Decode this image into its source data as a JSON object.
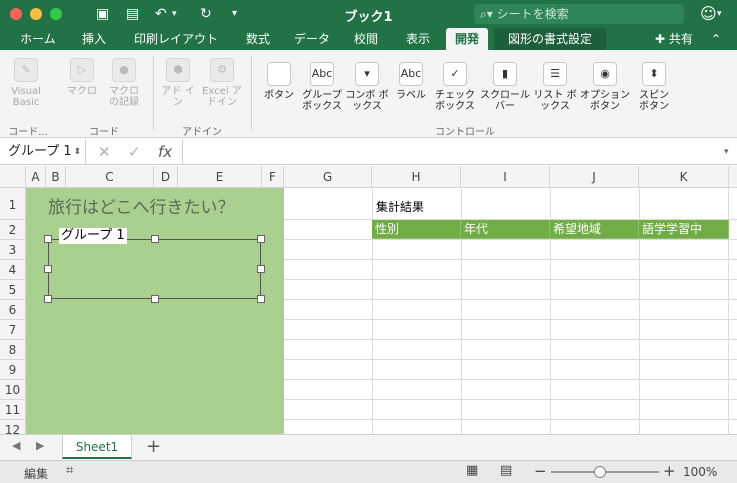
{
  "window": {
    "title": "ブック1",
    "search_placeholder": "シートを検索"
  },
  "toolbar": {
    "undo_label": "↶",
    "redo_label": "↻"
  },
  "tabs": [
    {
      "label": "ホーム"
    },
    {
      "label": "挿入"
    },
    {
      "label": "印刷レイアウト"
    },
    {
      "label": "数式"
    },
    {
      "label": "データ"
    },
    {
      "label": "校閲"
    },
    {
      "label": "表示"
    },
    {
      "label": "開発"
    },
    {
      "label": "図形の書式設定"
    }
  ],
  "share_label": "共有",
  "ribbon": {
    "code": {
      "visual_basic": "Visual Basic",
      "macro": "マクロ",
      "macro_record": "マクロ の記録",
      "group_left": "コード...",
      "group": "コード"
    },
    "addin": {
      "addin": "アド イン",
      "excel_addin": "Excel アドイン",
      "group": "アドイン"
    },
    "controls": {
      "items": [
        {
          "label": "ボタン",
          "icon": ""
        },
        {
          "label": "グループ ボックス",
          "icon": "Abc"
        },
        {
          "label": "コンボ ボックス",
          "icon": "▾"
        },
        {
          "label": "ラベル",
          "icon": "Abc"
        },
        {
          "label": "チェック ボックス",
          "icon": "✓"
        },
        {
          "label": "スクロール バー",
          "icon": "▮"
        },
        {
          "label": "リスト ボックス",
          "icon": "☰"
        },
        {
          "label": "オプション ボタン",
          "icon": "◉"
        },
        {
          "label": "スピン ボタン",
          "icon": "⬍"
        }
      ],
      "group": "コントロール"
    }
  },
  "formula_bar": {
    "name_box": "グループ 1",
    "fx": "fx"
  },
  "columns": [
    "A",
    "B",
    "C",
    "D",
    "E",
    "F",
    "G",
    "H",
    "I",
    "J",
    "K"
  ],
  "rows": [
    "1",
    "2",
    "3",
    "4",
    "5",
    "6",
    "7",
    "8",
    "9",
    "10",
    "11",
    "12"
  ],
  "sheet": {
    "question": "旅行はどこへ行きたい？",
    "group_label": "グループ 1",
    "summary_title": "集計結果",
    "table_headers": [
      "性別",
      "年代",
      "希望地域",
      "語学学習中"
    ],
    "header_color": "#70ad47",
    "panel_color": "#a9d08e"
  },
  "sheet_tabs": [
    {
      "label": "Sheet1"
    }
  ],
  "status": {
    "mode": "編集",
    "zoom": "100%"
  }
}
